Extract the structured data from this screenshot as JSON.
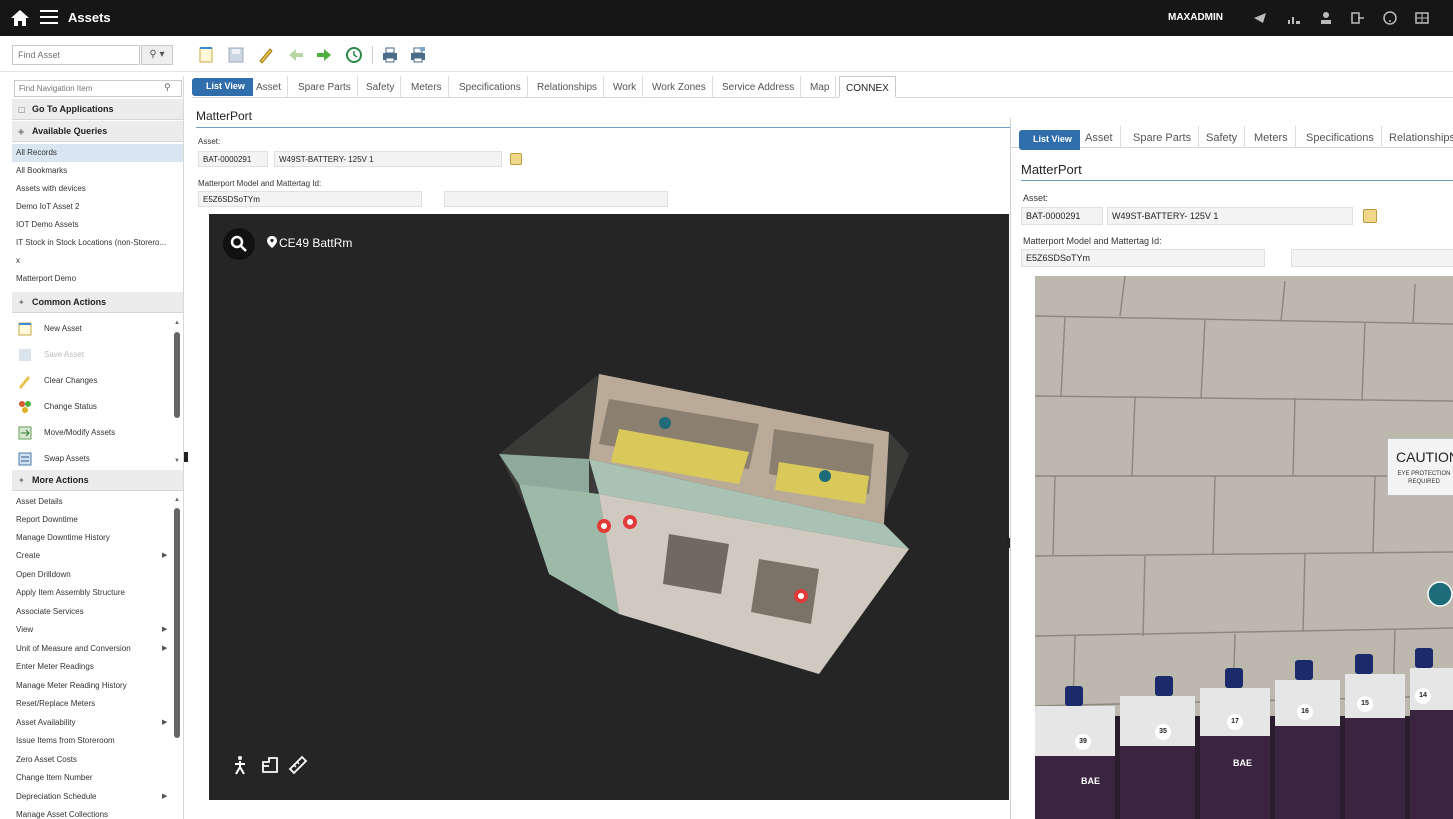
{
  "topbar": {
    "app_title": "Assets",
    "user": "MAXADMIN",
    "colors": {
      "background": "#161616",
      "text": "#ffffff"
    }
  },
  "toolbar": {
    "find_asset_placeholder": "Find Asset",
    "icons": [
      "new-record-icon",
      "save-icon",
      "clear-changes-icon",
      "previous-record-icon",
      "next-record-icon",
      "history-icon",
      "print-icon",
      "print-all-icon"
    ]
  },
  "sidebar": {
    "nav_search_placeholder": "Find Navigation Item",
    "go_to_applications": "Go To Applications",
    "available_queries": "Available Queries",
    "queries": [
      "All Records",
      "All Bookmarks",
      "Assets with devices",
      "Demo IoT Asset 2",
      "IOT Demo Assets",
      "IT Stock in Stock Locations (non-Storero...",
      "x",
      "Matterport Demo"
    ],
    "common_actions": "Common Actions",
    "actions": [
      {
        "label": "New Asset",
        "icon": "new-asset-icon"
      },
      {
        "label": "Save Asset",
        "icon": "save-asset-icon"
      },
      {
        "label": "Clear Changes",
        "icon": "clear-changes-icon"
      },
      {
        "label": "Change Status",
        "icon": "change-status-icon"
      },
      {
        "label": "Move/Modify Assets",
        "icon": "move-modify-icon"
      },
      {
        "label": "Swap Assets",
        "icon": "swap-assets-icon"
      }
    ],
    "more_actions": "More Actions",
    "more": [
      "Asset Details",
      "Report Downtime",
      "Manage Downtime History",
      "Create",
      "Open Drilldown",
      "Apply Item Assembly Structure",
      "Associate Services",
      "View",
      "Unit of Measure and Conversion",
      "Enter Meter Readings",
      "Manage Meter Reading History",
      "Reset/Replace Meters",
      "Asset Availability",
      "Issue Items from Storeroom",
      "Zero Asset Costs",
      "Change Item Number",
      "Depreciation Schedule",
      "Manage Asset Collections"
    ]
  },
  "tabs": {
    "list_view": "List View",
    "items": [
      "Asset",
      "Spare Parts",
      "Safety",
      "Meters",
      "Specifications",
      "Relationships",
      "Work",
      "Work Zones",
      "Service Address",
      "Map",
      "CONNEX"
    ]
  },
  "main": {
    "section_title": "MatterPort",
    "asset_label": "Asset:",
    "asset_id": "BAT-0000291",
    "asset_desc": "W49ST-BATTERY- 125V 1",
    "model_label": "Matterport Model and Mattertag Id:",
    "model_id": "E5Z6SDSoTYm",
    "viewer_room": "CE49 BattRm"
  },
  "right_window": {
    "list_view": "List View",
    "tabs": [
      "Asset",
      "Spare Parts",
      "Safety",
      "Meters",
      "Specifications",
      "Relationships"
    ],
    "section_title": "MatterPort",
    "asset_label": "Asset:",
    "asset_id": "BAT-0000291",
    "asset_desc": "W49ST-BATTERY- 125V 1",
    "model_label": "Matterport Model and Mattertag Id:",
    "model_id": "E5Z6SDSoTYm",
    "caution_title": "CAUTION",
    "caution_sub": "EYE PROTECTION REQUIRED",
    "battery_numbers": [
      "39",
      "35",
      "17",
      "16",
      "15",
      "14"
    ],
    "battery_brand": "BAE"
  }
}
